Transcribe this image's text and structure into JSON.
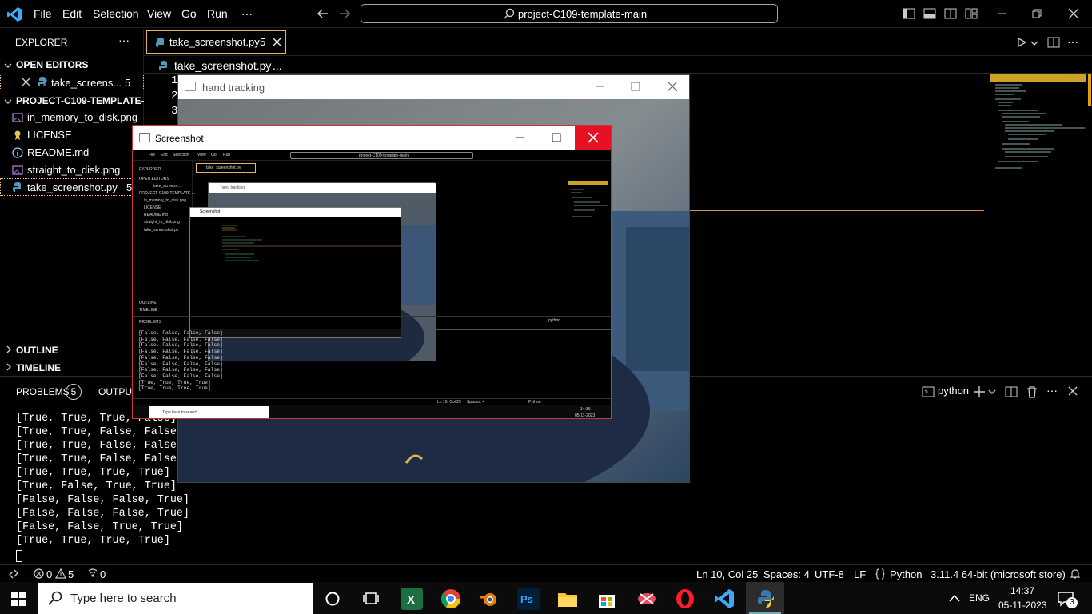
{
  "menu": {
    "file": "File",
    "edit": "Edit",
    "selection": "Selection",
    "view": "View",
    "go": "Go",
    "run": "Run",
    "more": "···"
  },
  "command_center": "project-C109-template-main",
  "explorer": {
    "title": "EXPLORER",
    "more": "···",
    "open_editors": "OPEN EDITORS",
    "open_file": "take_screens...",
    "open_file_badge": "5",
    "project": "PROJECT-C109-TEMPLATE-...",
    "files": [
      {
        "name": "in_memory_to_disk.png",
        "icon": "image-icon"
      },
      {
        "name": "LICENSE",
        "icon": "license-icon"
      },
      {
        "name": "README.md",
        "icon": "info-icon"
      },
      {
        "name": "straight_to_disk.png",
        "icon": "image-icon"
      },
      {
        "name": "take_screenshot.py",
        "icon": "python-icon",
        "badge": "5"
      }
    ],
    "outline": "OUTLINE",
    "timeline": "TIMELINE"
  },
  "tab": {
    "label": "take_screenshot.py",
    "badge": "5"
  },
  "breadcrumb": {
    "file": "take_screenshot.py",
    "sep": "›",
    "rest": "..."
  },
  "line_numbers": [
    "1",
    "2",
    "3"
  ],
  "hand_window": {
    "title": "hand tracking"
  },
  "shot_window": {
    "title": "Screenshot"
  },
  "panel": {
    "problems": "PROBLEMS",
    "problems_count": "5",
    "output": "OUTPUT",
    "terminal_name": "python",
    "lines": [
      "[True, True, True, False]",
      "[True, True, False, False]",
      "[True, True, False, False]",
      "[True, True, False, False]",
      "[True, True, True, True]",
      "[True, False, True, True]",
      "[False, False, False, True]",
      "[False, False, False, True]",
      "[False, False, True, True]",
      "[True, True, True, True]"
    ]
  },
  "status": {
    "errors": "0",
    "warnings": "5",
    "ports": "0",
    "position": "Ln 10, Col 25",
    "spaces": "Spaces: 4",
    "encoding": "UTF-8",
    "eol": "LF",
    "language": "Python",
    "interpreter": "3.11.4 64-bit (microsoft store)"
  },
  "taskbar": {
    "search_placeholder": "Type here to search",
    "lang": "ENG",
    "time": "14:37",
    "date": "05-11-2023",
    "notifications": "3"
  },
  "nested": {
    "term_lines": [
      "[False, False, False, False]",
      "[False, False, False, False]",
      "[False, False, False, False]",
      "[False, False, False, False]",
      "[False, False, False, False]",
      "[False, False, False, False]",
      "[False, False, False, False]",
      "[False, False, False, False]",
      "[True, True, True, True]",
      "[True, True, True, True]"
    ],
    "time": "14:36",
    "date": "05-11-2023",
    "search": "Type here to search"
  }
}
